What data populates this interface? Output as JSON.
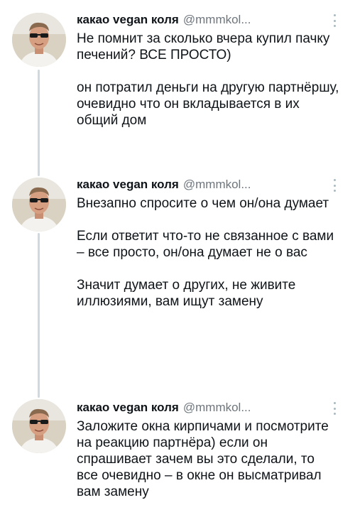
{
  "tweets": [
    {
      "author_name": "какао vegan коля",
      "author_handle": "@mmmkol...",
      "paragraphs": [
        "Не помнит за сколько вчера купил пачку печений? ВСЕ ПРОСТО)",
        "он потратил деньги на другую партнёршу, очевидно что он вкладывается в их общий дом"
      ]
    },
    {
      "author_name": "какао vegan коля",
      "author_handle": "@mmmkol...",
      "paragraphs": [
        "Внезапно спросите о чем он/она думает",
        "Если ответит что-то не связанное с вами – все просто, он/она думает не о вас",
        "Значит думает о других, не живите иллюзиями, вам ищут замену"
      ]
    },
    {
      "author_name": "какао vegan коля",
      "author_handle": "@mmmkol...",
      "paragraphs": [
        "Заложите окна кирпичами и посмотрите на реакцию партнёра) если он спрашивает зачем вы это сделали, то все очевидно – в окне он высматривал вам замену"
      ]
    }
  ]
}
